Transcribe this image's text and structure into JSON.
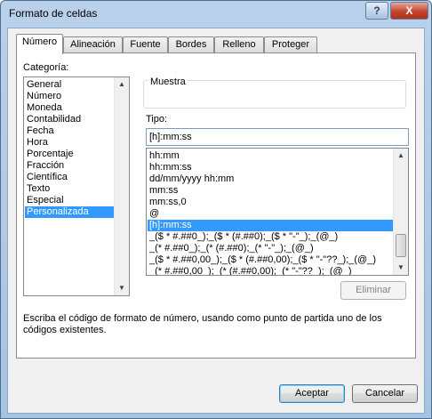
{
  "window": {
    "title": "Formato de celdas",
    "help_glyph": "?",
    "close_glyph": "X"
  },
  "tabs": [
    {
      "label": "Número",
      "active": true
    },
    {
      "label": "Alineación"
    },
    {
      "label": "Fuente"
    },
    {
      "label": "Bordes"
    },
    {
      "label": "Relleno"
    },
    {
      "label": "Proteger"
    }
  ],
  "category": {
    "label": "Categoría:",
    "items": [
      "General",
      "Número",
      "Moneda",
      "Contabilidad",
      "Fecha",
      "Hora",
      "Porcentaje",
      "Fracción",
      "Científica",
      "Texto",
      "Especial",
      "Personalizada"
    ],
    "selected": "Personalizada"
  },
  "sample": {
    "label": "Muestra"
  },
  "type": {
    "label": "Tipo:",
    "value": "[h]:mm:ss",
    "items": [
      "hh:mm",
      "hh:mm:ss",
      "dd/mm/yyyy hh:mm",
      "mm:ss",
      "mm:ss,0",
      "@",
      "[h]:mm:ss",
      "_($ * #.##0_);_($ * (#.##0);_($ * \"-\"_);_(@_)",
      "_(* #.##0_);_(* (#.##0);_(* \"-\"_);_(@_)",
      "_($ * #.##0,00_);_($ * (#.##0,00);_($ * \"-\"??_);_(@_)",
      "_(* #.##0,00_);_(* (#.##0,00);_(* \"-\"??_);_(@_)"
    ],
    "selected": "[h]:mm:ss"
  },
  "buttons": {
    "delete": "Eliminar",
    "ok": "Aceptar",
    "cancel": "Cancelar"
  },
  "description": "Escriba el código de formato de número, usando como punto de partida uno de los códigos existentes.",
  "icons": {
    "scroll_up": "▲",
    "scroll_down": "▼"
  },
  "colors": {
    "selection": "#3399ff",
    "close_button": "#c3452e"
  }
}
